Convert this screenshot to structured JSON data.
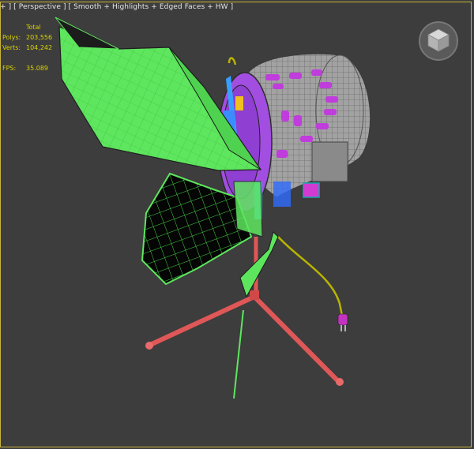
{
  "viewport": {
    "label_parts": [
      "+ ]",
      " [ ",
      "Perspective",
      " ] [ ",
      "Smooth + Highlights + Edged Faces + HW",
      " ]"
    ],
    "stats": {
      "header": "Total",
      "polys_label": "Polys:",
      "polys_value": "203,556",
      "verts_label": "Verts:",
      "verts_value": "104,242",
      "fps_label": "FPS:",
      "fps_value": "35.089"
    },
    "viewcube_icon": "viewcube-icon"
  },
  "colors": {
    "background": "#3d3d3d",
    "border": "#c8b43a",
    "stats_text": "#d8d200",
    "barn_door_green": "#5de65d",
    "stand_red": "#e05252",
    "body_grey": "#9a9a9a",
    "accent_purple": "#b35cff",
    "cable_yellow": "#b8b400"
  }
}
